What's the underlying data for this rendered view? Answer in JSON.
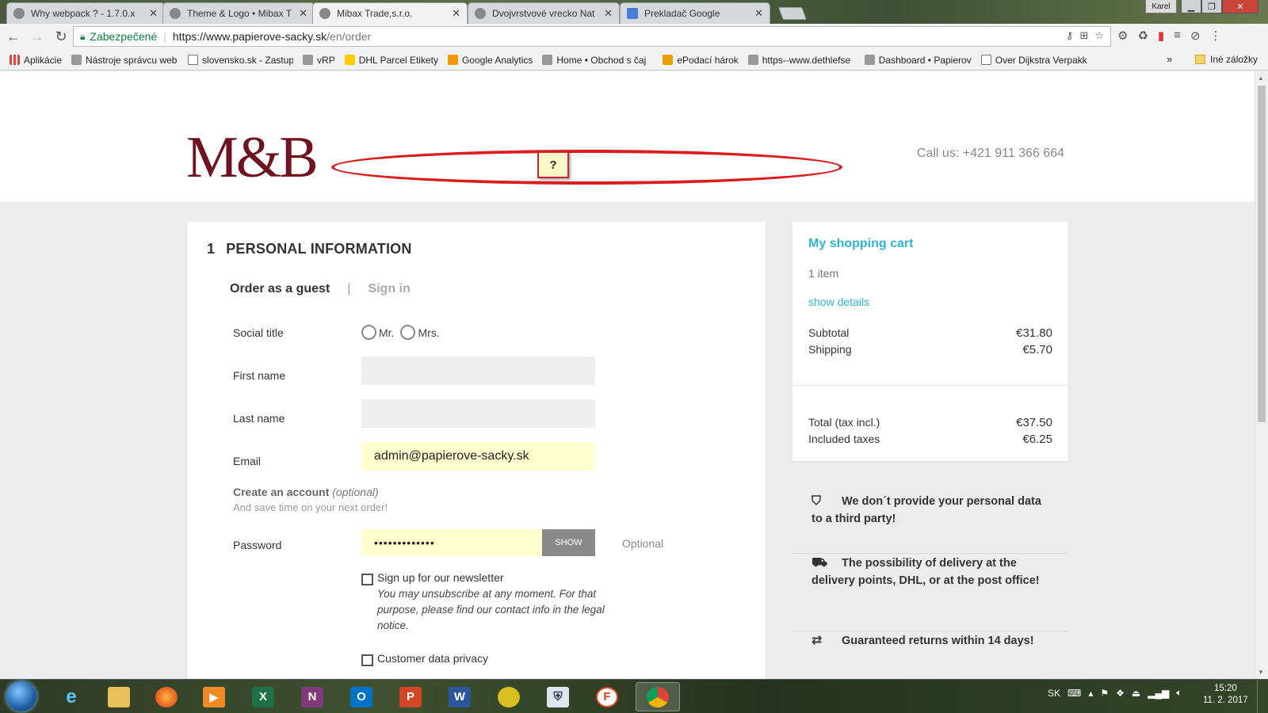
{
  "browser": {
    "tabs": [
      {
        "title": "Why webpack ? - 1.7.0.x"
      },
      {
        "title": "Theme & Logo • Mibax T"
      },
      {
        "title": "Mibax Trade,s.r.o."
      },
      {
        "title": "Dvojvrstvové vrecko Nat"
      },
      {
        "title": "Prekladač Google"
      }
    ],
    "profile": "Karel",
    "omnibox": {
      "secure_label": "Zabezpečené",
      "host": "https://www.papierove-sacky.sk",
      "path": "/en/order"
    },
    "bookmarks": [
      "Aplikácie",
      "Nástroje správcu web",
      "slovensko.sk - Zastup",
      "vRP",
      "DHL Parcel Etikety",
      "Google Analytics",
      "Home • Obchod s čaj",
      "ePodací hárok",
      "https--www.dethlefse",
      "Dashboard • Papierov",
      "Over Dijkstra Verpakk"
    ],
    "bookmarks_more": "»",
    "bookmarks_other": "Iné záložky"
  },
  "site": {
    "logo": "M&B",
    "annotation": "?",
    "call_us": "Call us: +421 911 366 664"
  },
  "checkout": {
    "step_number": "1",
    "step_title": "PERSONAL INFORMATION",
    "tab_guest": "Order as a guest",
    "tab_separator": "|",
    "tab_signin": "Sign in",
    "social_title_label": "Social title",
    "mr_label": "Mr.",
    "mrs_label": "Mrs.",
    "first_name_label": "First name",
    "first_name_value": "",
    "last_name_label": "Last name",
    "last_name_value": "",
    "email_label": "Email",
    "email_value": "admin@papierove-sacky.sk",
    "create_account_bold": "Create an account",
    "create_account_optional": "(optional)",
    "create_account_sub": "And save time on your next order!",
    "password_label": "Password",
    "password_value": "•••••••••••••",
    "show_button": "SHOW",
    "optional_label": "Optional",
    "newsletter_label": "Sign up for our newsletter",
    "newsletter_note": "You may unsubscribe at any moment. For that purpose, please find our contact info in the legal notice.",
    "privacy_label": "Customer data privacy"
  },
  "cart": {
    "title": "My shopping cart",
    "items": "1 item",
    "show_details": "show details",
    "subtotal_label": "Subtotal",
    "subtotal_value": "€31.80",
    "shipping_label": "Shipping",
    "shipping_value": "€5.70",
    "total_label": "Total (tax incl.)",
    "total_value": "€37.50",
    "taxes_label": "Included taxes",
    "taxes_value": "€6.25"
  },
  "reassurance": [
    {
      "icon": "shield-check-icon",
      "text": "We don´t provide your personal data to a third party!"
    },
    {
      "icon": "truck-icon",
      "text": "The possibility of delivery at the delivery points, DHL, or at the post office!"
    },
    {
      "icon": "swap-arrows-icon",
      "text": "Guaranteed returns within 14 days!"
    }
  ],
  "taskbar": {
    "apps": [
      "internet-explorer",
      "file-explorer",
      "firefox",
      "media-player",
      "excel",
      "onenote",
      "outlook",
      "powerpoint",
      "word",
      "coins-app",
      "vpn-app",
      "f-app",
      "chrome"
    ],
    "lang": "SK",
    "time": "15:20",
    "date": "11. 2. 2017"
  },
  "colors": {
    "brand": "#6e1420",
    "accent": "#2fb5d2",
    "annotation_red": "#d81e1e",
    "autofill": "#ffffcf"
  }
}
